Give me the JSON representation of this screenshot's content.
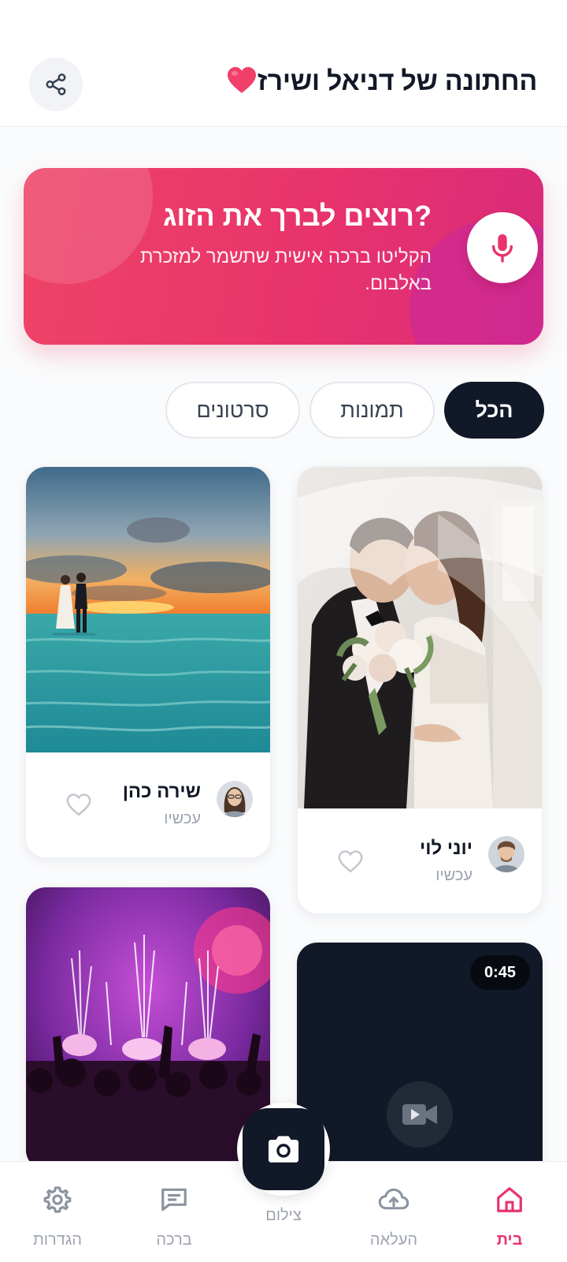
{
  "header": {
    "title": "החתונה של דניאל ושירז",
    "share_icon": "share-icon"
  },
  "banner": {
    "title": "?רוצים לברך את הזוג",
    "subtitle": "הקליטו ברכה אישית שתשמר למזכרת באלבום.",
    "mic_icon": "microphone-icon",
    "accent": "#e8336c"
  },
  "filters": [
    {
      "label": "הכל",
      "selected": true
    },
    {
      "label": "תמונות",
      "selected": false
    },
    {
      "label": "סרטונים",
      "selected": false
    }
  ],
  "feed": [
    {
      "author": "יוני לוי",
      "time": "עכשיו",
      "media": "bride-groom-veil-kiss",
      "liked": false
    },
    {
      "author": "שירה כהן",
      "time": "עכשיו",
      "media": "couple-beach-sunset",
      "liked": false
    },
    {
      "media": "concert-fireworks-crowd"
    },
    {
      "media": "video",
      "duration": "0:45"
    }
  ],
  "bottom_nav": {
    "items": [
      {
        "label": "בית",
        "icon": "home-icon",
        "active": true
      },
      {
        "label": "העלאה",
        "icon": "cloud-upload-icon",
        "active": false
      },
      {
        "label": "צילום",
        "icon": "camera-icon",
        "active": false
      },
      {
        "label": "ברכה",
        "icon": "message-icon",
        "active": false
      },
      {
        "label": "הגדרות",
        "icon": "gear-icon",
        "active": false
      }
    ]
  },
  "colors": {
    "accent": "#e8336c",
    "dark": "#111827",
    "muted": "#9ca3af"
  }
}
